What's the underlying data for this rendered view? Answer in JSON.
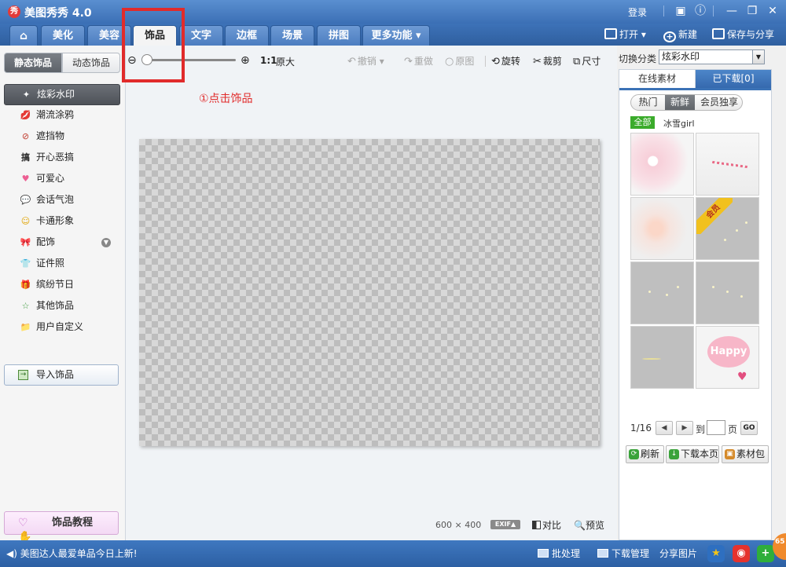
{
  "window": {
    "title": "美图秀秀 4.0",
    "logo_text": "秀",
    "login": "登录"
  },
  "tabs": [
    {
      "label": "美化"
    },
    {
      "label": "美容"
    },
    {
      "label": "饰品"
    },
    {
      "label": "文字"
    },
    {
      "label": "边框"
    },
    {
      "label": "场景"
    },
    {
      "label": "拼图"
    },
    {
      "label": "更多功能 ▾"
    }
  ],
  "active_tab": "饰品",
  "topright": {
    "open": "打开",
    "new": "新建",
    "save_share": "保存与分享"
  },
  "left": {
    "subtabs": {
      "static": "静态饰品",
      "dynamic": "动态饰品"
    },
    "categories": [
      {
        "label": "炫彩水印",
        "icon": "✦"
      },
      {
        "label": "潮流涂鸦",
        "icon": "💋"
      },
      {
        "label": "遮挡物",
        "icon": "⊘"
      },
      {
        "label": "开心恶搞",
        "icon": "搞"
      },
      {
        "label": "可爱心",
        "icon": "♥"
      },
      {
        "label": "会话气泡",
        "icon": "💬"
      },
      {
        "label": "卡通形象",
        "icon": "☺"
      },
      {
        "label": "配饰",
        "icon": "🎀"
      },
      {
        "label": "证件照",
        "icon": "👕"
      },
      {
        "label": "缤纷节日",
        "icon": "🎁"
      },
      {
        "label": "其他饰品",
        "icon": "☆"
      },
      {
        "label": "用户自定义",
        "icon": "📁"
      }
    ],
    "import_label": "导入饰品",
    "tutorial_label": "饰品教程"
  },
  "toolbar": {
    "ratio": "1:1",
    "original_size": "原大",
    "undo": "撤销",
    "redo": "重做",
    "original": "原图",
    "rotate": "旋转",
    "crop": "裁剪",
    "size": "尺寸"
  },
  "annotation": "①点击饰品",
  "canvas": {
    "image_size": "600 × 400",
    "exif": "EXIF▲",
    "compare": "对比",
    "preview": "预览"
  },
  "right": {
    "switch_label": "切换分类",
    "switch_value": "炫彩水印",
    "tabs": {
      "online": "在线素材",
      "downloaded": "已下载[0]"
    },
    "pills": [
      "热门",
      "新鲜",
      "会员独享"
    ],
    "active_pill": "新鲜",
    "filter_all": "全部",
    "filter_tag": "冰雪girl",
    "vip_ribbon": "会员",
    "happy_text": "Happy",
    "pager": {
      "page": "1/16",
      "goto": "到",
      "unit": "页",
      "go": "GO"
    },
    "buttons": {
      "refresh": "刷新",
      "download_page": "下载本页",
      "package": "素材包"
    }
  },
  "status": {
    "message": "美图达人最爱单品今日上新!",
    "batch": "批处理",
    "download_mgr": "下载管理",
    "share_image": "分享图片",
    "corner_badge": "65"
  }
}
